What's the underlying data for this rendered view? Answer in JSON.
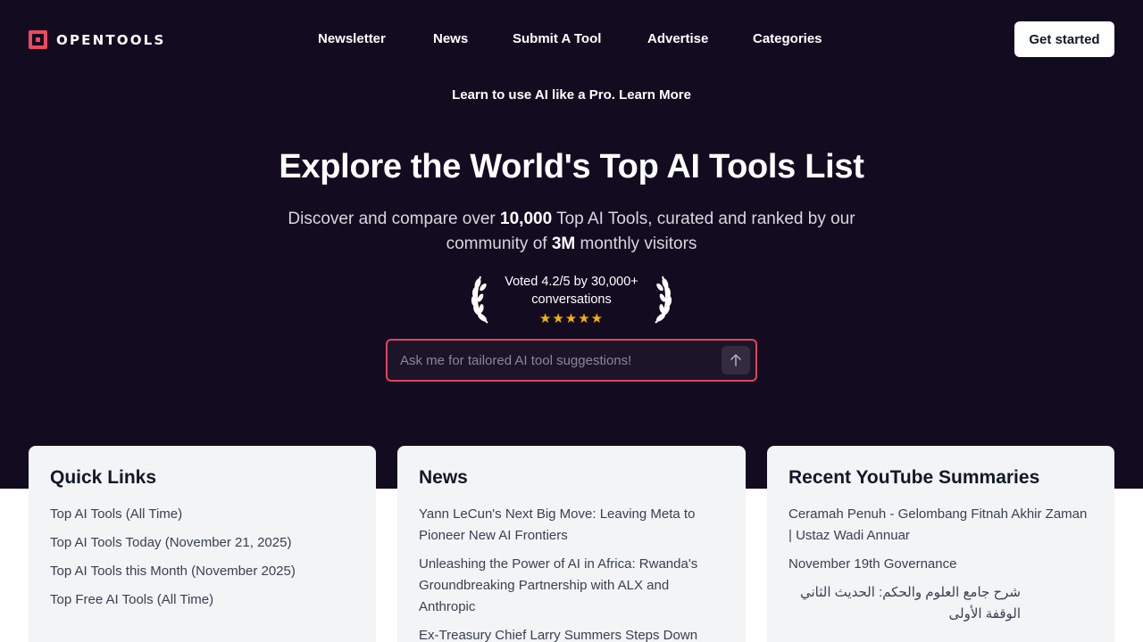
{
  "brand": {
    "name": "OPENTOOLS"
  },
  "nav": [
    "Newsletter",
    "News",
    "Submit A Tool",
    "Advertise",
    "Categories"
  ],
  "cta": "Get started",
  "promo": "Learn to use AI like a Pro. Learn More",
  "hero": {
    "title": "Explore the World's Top AI Tools List",
    "sub_1": "Discover and compare over ",
    "sub_num": "10,000",
    "sub_2": " Top AI Tools, curated and ranked by our community of ",
    "sub_visitors": "3M",
    "sub_3": " monthly visitors"
  },
  "rating": {
    "text": "Voted 4.2/5 by 30,000+ conversations",
    "stars": 5
  },
  "search": {
    "placeholder": "Ask me for tailored AI tool suggestions!"
  },
  "quick_links": {
    "title": "Quick Links",
    "items": [
      "Top AI Tools (All Time)",
      "Top AI Tools Today (November 21, 2025)",
      "Top AI Tools this Month (November 2025)",
      "Top Free AI Tools (All Time)"
    ]
  },
  "news": {
    "title": "News",
    "items": [
      "Yann LeCun's Next Big Move: Leaving Meta to Pioneer New AI Frontiers",
      "Unleashing the Power of AI in Africa: Rwanda's Groundbreaking Partnership with ALX and Anthropic",
      "Ex-Treasury Chief Larry Summers Steps Down"
    ]
  },
  "youtube": {
    "title": "Recent YouTube Summaries",
    "items": [
      "Ceramah Penuh - Gelombang Fitnah Akhir Zaman | Ustaz Wadi Annuar",
      "November 19th Governance",
      "شرح جامع العلوم والحكم: الحديث الثاني الوقفة الأولى"
    ]
  },
  "colors": {
    "hero_bg": "#130b20",
    "accent": "#ec4a60",
    "star": "#f5b400",
    "card_bg": "#f3f4f6"
  },
  "icons": {
    "send": "arrow-up-icon",
    "rating": "laurel-icon",
    "star": "star-icon"
  }
}
